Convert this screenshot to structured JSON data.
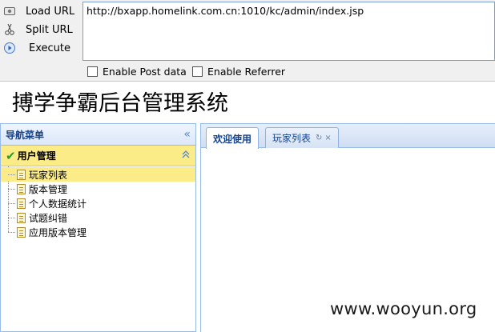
{
  "hackbar": {
    "load_label": "Load URL",
    "split_label": "Split URL",
    "execute_label": "Execute",
    "url": "http://bxapp.homelink.com.cn:1010/kc/admin/index.jsp",
    "post_label": "Enable Post data",
    "referrer_label": "Enable Referrer"
  },
  "page": {
    "title": "搏学争霸后台管理系统"
  },
  "nav": {
    "title": "导航菜单",
    "collapse_icon": "«",
    "group": {
      "label": "用户管理",
      "check_icon": "✔",
      "toggle_icon": "⌃"
    },
    "items": [
      {
        "label": "玩家列表"
      },
      {
        "label": "版本管理"
      },
      {
        "label": "个人数据统计"
      },
      {
        "label": "试题纠错"
      },
      {
        "label": "应用版本管理"
      }
    ]
  },
  "tabs": {
    "welcome": "欢迎使用",
    "players": "玩家列表",
    "refresh_icon": "↻",
    "close_icon": "×"
  },
  "watermark": "www.wooyun.org"
}
